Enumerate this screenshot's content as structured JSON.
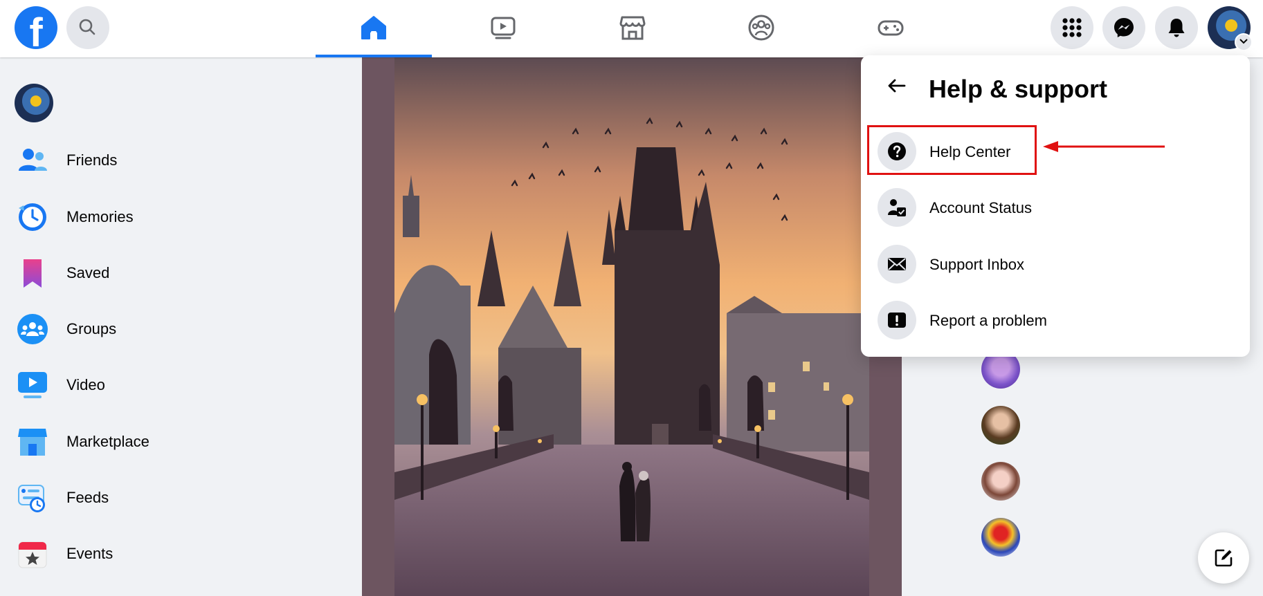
{
  "header": {
    "logo_letter": "f",
    "icons": {
      "search": "search-icon",
      "home": "home-icon",
      "watch": "video-icon",
      "marketplace": "marketplace-icon",
      "groups": "groups-icon",
      "gaming": "gaming-icon",
      "menu": "grid-menu-icon",
      "messenger": "messenger-icon",
      "notifications": "bell-icon"
    },
    "active_tab": "home",
    "accent": "#1877f2"
  },
  "sidebar": {
    "items": [
      {
        "label": "Friends",
        "icon": "friends-icon"
      },
      {
        "label": "Memories",
        "icon": "memories-icon"
      },
      {
        "label": "Saved",
        "icon": "saved-icon"
      },
      {
        "label": "Groups",
        "icon": "groups-icon"
      },
      {
        "label": "Video",
        "icon": "video-icon"
      },
      {
        "label": "Marketplace",
        "icon": "marketplace-icon"
      },
      {
        "label": "Feeds",
        "icon": "feeds-icon"
      },
      {
        "label": "Events",
        "icon": "events-icon"
      }
    ]
  },
  "help_panel": {
    "title": "Help & support",
    "items": [
      {
        "label": "Help Center",
        "icon": "question-icon",
        "highlighted": true
      },
      {
        "label": "Account Status",
        "icon": "account-status-icon"
      },
      {
        "label": "Support Inbox",
        "icon": "envelope-icon"
      },
      {
        "label": "Report a problem",
        "icon": "exclamation-icon"
      }
    ],
    "highlight_color": "#e01111"
  }
}
